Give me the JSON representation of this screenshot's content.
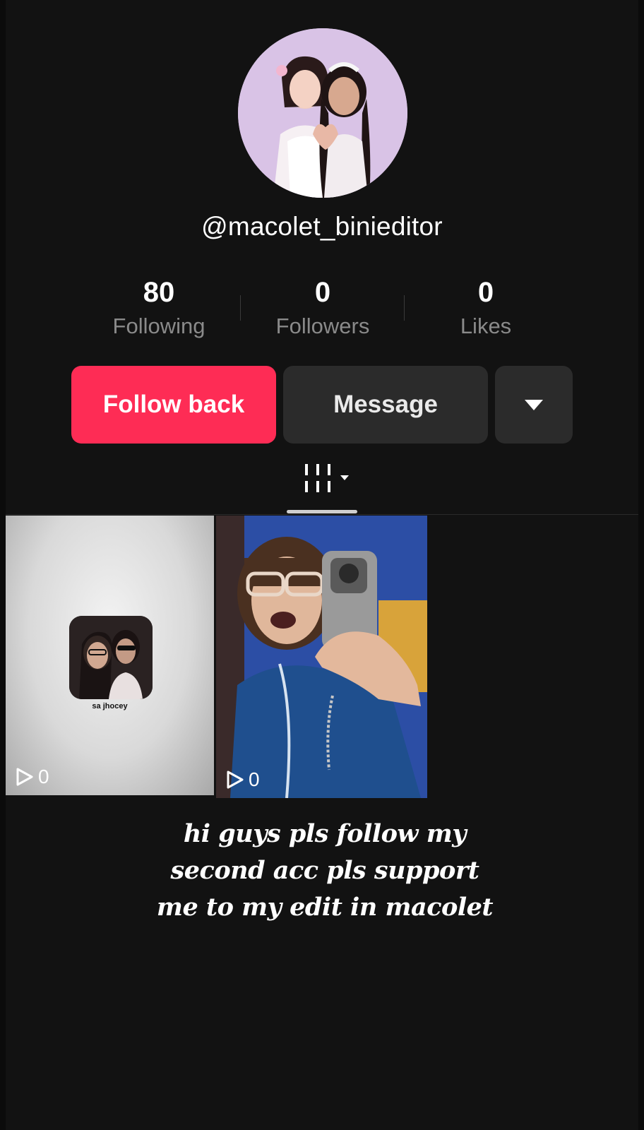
{
  "profile": {
    "username": "@macolet_binieditor",
    "avatar_icon": "profile-photo"
  },
  "stats": {
    "following": {
      "value": "80",
      "label": "Following"
    },
    "followers": {
      "value": "0",
      "label": "Followers"
    },
    "likes": {
      "value": "0",
      "label": "Likes"
    }
  },
  "actions": {
    "follow_back": "Follow back",
    "message": "Message",
    "more_icon": "caret-down-icon"
  },
  "tabs": {
    "active_icon": "grid-tab-icon"
  },
  "videos": [
    {
      "views": "0",
      "caption": "sa jhocey"
    },
    {
      "views": "0"
    }
  ],
  "overlay": {
    "lines": [
      "hi guys pls follow my",
      "second acc pls support",
      "me to my edit in macolet"
    ]
  },
  "colors": {
    "accent": "#fe2c55",
    "background": "#121212",
    "secondary_button": "#2b2b2b",
    "muted_text": "#8a8a8a"
  }
}
